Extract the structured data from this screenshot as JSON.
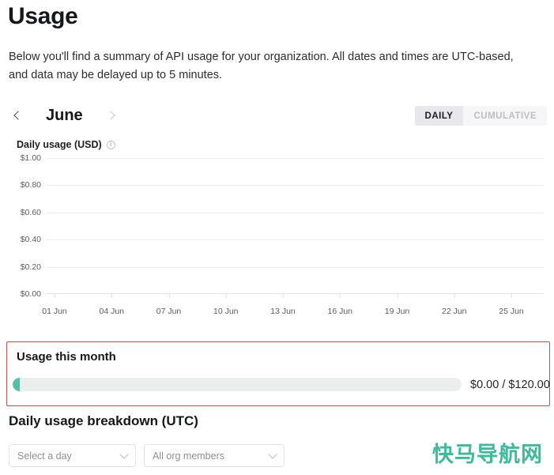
{
  "header": {
    "title": "Usage",
    "description": "Below you'll find a summary of API usage for your organization. All dates and times are UTC-based, and data may be delayed up to 5 minutes."
  },
  "month_nav": {
    "prev_icon": "chevron-left-icon",
    "next_icon": "chevron-right-icon",
    "current_month": "June"
  },
  "view_toggle": {
    "options": [
      {
        "label": "DAILY",
        "selected": true
      },
      {
        "label": "CUMULATIVE",
        "selected": false
      }
    ]
  },
  "chart_panel": {
    "title": "Daily usage (USD)",
    "info_icon": "info-circle-icon",
    "info_glyph": "i"
  },
  "chart_data": {
    "type": "bar",
    "title": "Daily usage (USD)",
    "xlabel": "",
    "ylabel": "",
    "ylim": [
      0,
      1
    ],
    "grid": true,
    "legend": false,
    "categories": [
      "01 Jun",
      "04 Jun",
      "07 Jun",
      "10 Jun",
      "13 Jun",
      "16 Jun",
      "19 Jun",
      "22 Jun",
      "25 Jun"
    ],
    "values": [
      0,
      0,
      0,
      0,
      0,
      0,
      0,
      0,
      0
    ],
    "ytick_labels": [
      "$1.00",
      "$0.80",
      "$0.60",
      "$0.40",
      "$0.20",
      "$0.00"
    ],
    "ytick_values": [
      1.0,
      0.8,
      0.6,
      0.4,
      0.2,
      0.0
    ],
    "xtick_labels": [
      "01 Jun",
      "04 Jun",
      "07 Jun",
      "10 Jun",
      "13 Jun",
      "16 Jun",
      "19 Jun",
      "22 Jun",
      "25 Jun"
    ]
  },
  "usage_card": {
    "title": "Usage this month",
    "progress_percent": 0,
    "progress_text": "$0.00 / $120.00",
    "used": "$0.00",
    "limit": "$120.00",
    "border_color": "#c0504d",
    "fill_color": "#57bfa5"
  },
  "breakdown": {
    "title": "Daily usage breakdown (UTC)",
    "day_select": {
      "value": "Select a day",
      "caret_icon": "chevron-down-icon"
    },
    "member_select": {
      "value": "All org members",
      "caret_icon": "chevron-down-icon"
    }
  },
  "watermark": {
    "text": "快马导航网",
    "color": "#3bbb9a"
  }
}
